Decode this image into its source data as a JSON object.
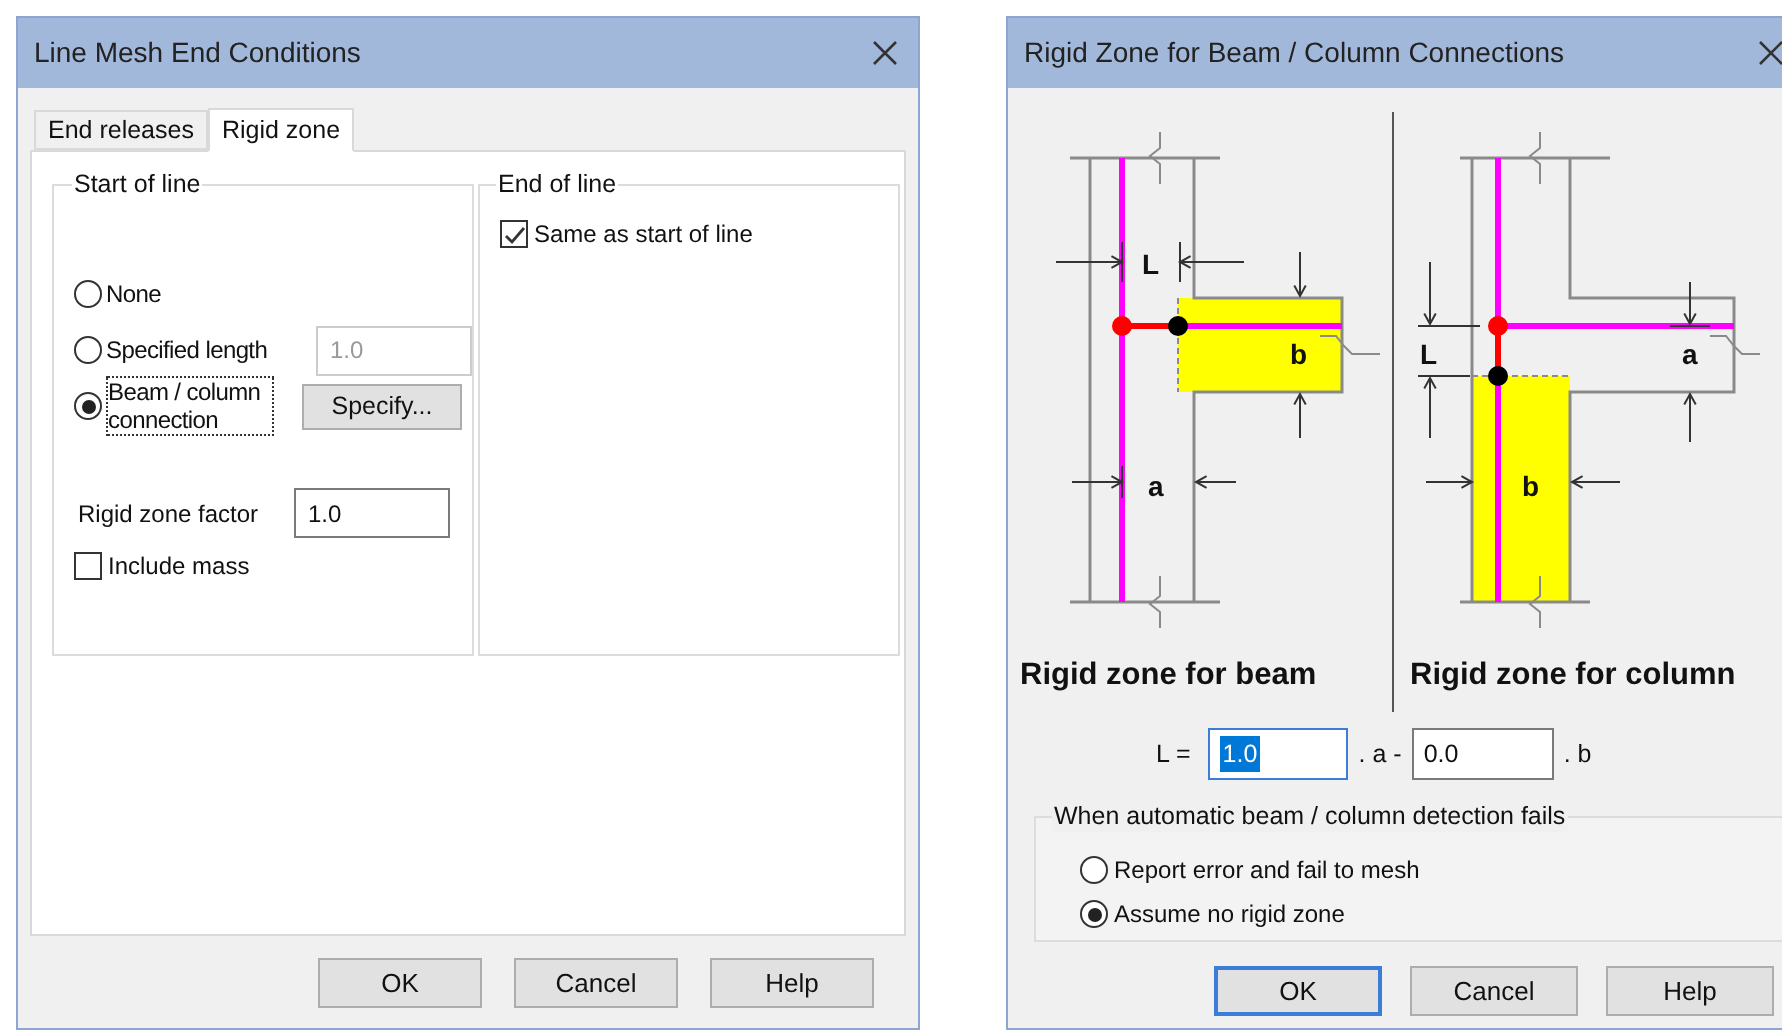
{
  "line_mesh_dialog": {
    "title": "Line Mesh End Conditions",
    "tabs": [
      {
        "label": "End releases",
        "selected": false
      },
      {
        "label": "Rigid zone",
        "selected": true
      }
    ],
    "start_of_line": {
      "title": "Start of line",
      "options": [
        {
          "kind": "plain",
          "label": "None",
          "selected": false
        },
        {
          "kind": "field",
          "label": "Specified length",
          "selected": false,
          "value": "1.0",
          "disabled": true
        },
        {
          "kind": "button",
          "label": "Beam / column connection",
          "selected": true,
          "focused": true,
          "button": "Specify..."
        }
      ],
      "factor_label": "Rigid zone factor",
      "factor_value": "1.0",
      "include_mass": {
        "label": "Include mass",
        "checked": false
      }
    },
    "end_of_line": {
      "title": "End of line",
      "same_as_start": {
        "label": "Same as start of line",
        "checked": true
      }
    },
    "buttons": [
      {
        "label": "OK",
        "default": false
      },
      {
        "label": "Cancel",
        "default": false
      },
      {
        "label": "Help",
        "default": false
      }
    ]
  },
  "rigid_zone_dialog": {
    "title": "Rigid Zone for Beam / Column Connections",
    "diagrams": [
      {
        "kind": "beam",
        "caption": "Rigid zone for beam",
        "labels": [
          "L",
          "b",
          "a"
        ]
      },
      {
        "kind": "column",
        "caption": "Rigid zone for column",
        "labels": [
          "L",
          "a",
          "b"
        ]
      }
    ],
    "formula": {
      "prefix": "L =",
      "l_value": "1.0",
      "middle": ". a -",
      "b_value": "0.0",
      "suffix": ". b"
    },
    "fallback": {
      "title": "When automatic beam / column detection fails",
      "options": [
        {
          "label": "Report error and fail to mesh",
          "selected": false
        },
        {
          "label": "Assume no rigid zone",
          "selected": true
        }
      ]
    },
    "buttons": [
      {
        "label": "OK",
        "default": true
      },
      {
        "label": "Cancel",
        "default": false
      },
      {
        "label": "Help",
        "default": false
      }
    ]
  }
}
